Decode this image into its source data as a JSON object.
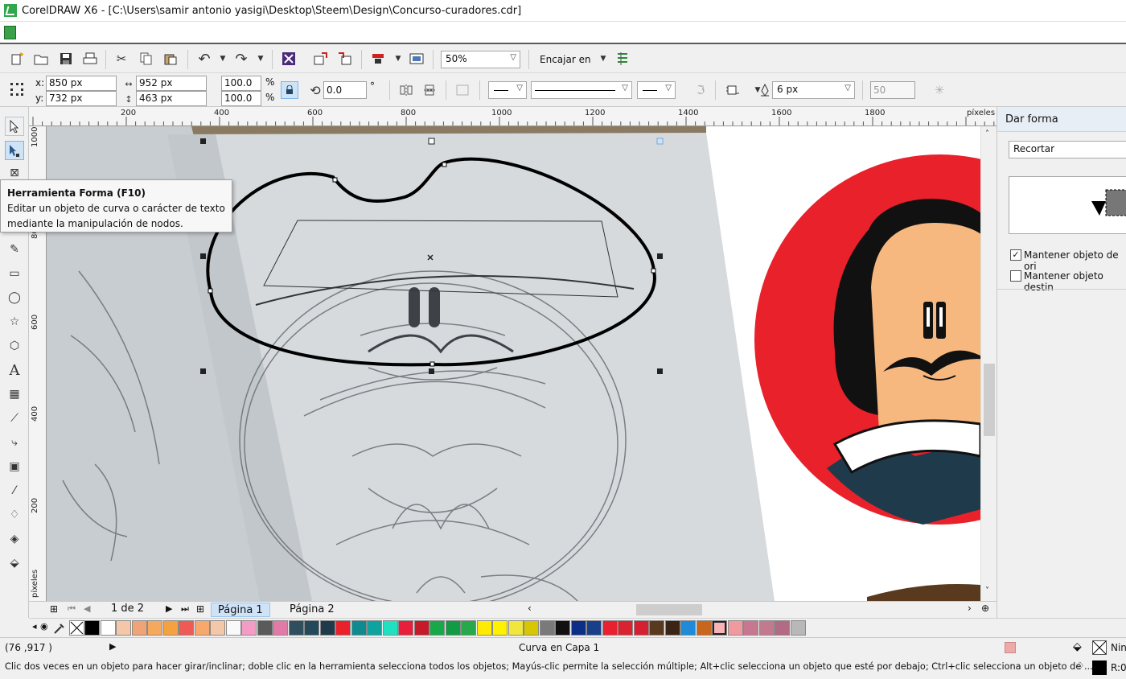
{
  "window": {
    "title": "CorelDRAW X6 - [C:\\Users\\samir antonio yasigi\\Desktop\\Steem\\Design\\Concurso-curadores.cdr]"
  },
  "toolbar": {
    "zoom_value": "50%",
    "snap_label": "Encajar en",
    "icons": [
      "new-icon",
      "open-icon",
      "save-icon",
      "print-icon",
      "cut-icon",
      "copy-icon",
      "paste-icon",
      "undo-icon",
      "redo-icon",
      "search-content-icon",
      "import-icon",
      "export-icon",
      "publish-icon",
      "application-launcher-icon",
      "welcome-screen-icon",
      "options-icon"
    ]
  },
  "property_bar": {
    "x_label": "x:",
    "x_value": "850 px",
    "y_label": "y:",
    "y_value": "732 px",
    "width_value": "952 px",
    "height_value": "463 px",
    "scale_x": "100.0",
    "scale_y": "100.0",
    "percent": "%",
    "rotation_value": "0.0",
    "degree_symbol": "°",
    "outline_width": "6 px",
    "nudge_value": "50"
  },
  "ruler": {
    "top_labels": [
      "200",
      "400",
      "600",
      "800",
      "1000",
      "1200",
      "1400",
      "1600",
      "1800"
    ],
    "unit": "píxeles",
    "left_labels": [
      "1000",
      "800",
      "600",
      "400",
      "200"
    ],
    "left_unit": "píxeles"
  },
  "tooltip": {
    "title": "Herramienta Forma (F10)",
    "body": "Editar un objeto de curva o carácter de texto mediante la manipulación de nodos."
  },
  "page_nav": {
    "counter": "1 de 2",
    "pages": [
      "Página 1",
      "Página 2"
    ]
  },
  "docker": {
    "title": "Dar forma",
    "mode": "Recortar",
    "options": [
      {
        "label": "Mantener objeto de ori",
        "checked": true
      },
      {
        "label": "Mantener objeto destin",
        "checked": false
      }
    ]
  },
  "palette": {
    "colors": [
      "#000000",
      "#ffffff",
      "#f4c7a8",
      "#eea477",
      "#f6a85c",
      "#f6a140",
      "#ee5a55",
      "#f7a86a",
      "#f4c7a8",
      "#f9f9f9",
      "#f39dc6",
      "#5a5a5a",
      "#e27aa8",
      "#2f4f5f",
      "#23495a",
      "#1f3a4a",
      "#e8212b",
      "#0f8a8f",
      "#0ea39f",
      "#1fe0c0",
      "#e81f3a",
      "#c41a2a",
      "#17a84a",
      "#129a45",
      "#27a84a",
      "#ffeb00",
      "#fff100",
      "#f0e63c",
      "#d8c700",
      "#7a7a7a",
      "#111111",
      "#0b2f86",
      "#1a3f8a",
      "#e8202f",
      "#da2331",
      "#d42030",
      "#5a3a1e",
      "#3a2414",
      "#1e8ad8",
      "#c8661e",
      "#f7b3b6",
      "#f09aa0",
      "#c77790",
      "#c27a8f",
      "#b36a84",
      "#b8b8b8"
    ],
    "selected_index": 40
  },
  "status": {
    "coords": "(76  ,917  )",
    "object_info": "Curva en Capa 1",
    "hint": "Clic dos veces en un objeto para hacer girar/inclinar; doble clic en la herramienta selecciona todos los objetos; Mayús-clic permite la selección múltiple; Alt+clic selecciona un objeto que esté por debajo; Ctrl+clic selecciona un objeto de ...",
    "fill_label": "Nin",
    "outline_label": "R:0"
  }
}
